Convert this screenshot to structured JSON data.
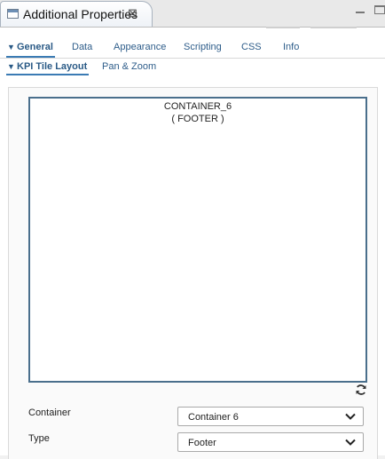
{
  "view": {
    "title": "Additional Properties",
    "close_glyph": "⊠"
  },
  "tabs": [
    {
      "label": "General",
      "active": true
    },
    {
      "label": "Data",
      "active": false
    },
    {
      "label": "Appearance",
      "active": false
    },
    {
      "label": "Scripting",
      "active": false
    },
    {
      "label": "CSS",
      "active": false
    },
    {
      "label": "Info",
      "active": false
    }
  ],
  "subtabs": [
    {
      "label": "KPI Tile Layout",
      "active": true
    },
    {
      "label": "Pan & Zoom",
      "active": false
    }
  ],
  "layout_canvas": {
    "container_name": "CONTAINER_6",
    "container_type": "( FOOTER )"
  },
  "fields": {
    "container": {
      "label": "Container",
      "value": "Container 6"
    },
    "type": {
      "label": "Type",
      "value": "Footer"
    }
  },
  "colors": {
    "accent": "#3b7bb4",
    "canvas_border": "#4a6f8c",
    "tab_text": "#2e5d8a"
  }
}
